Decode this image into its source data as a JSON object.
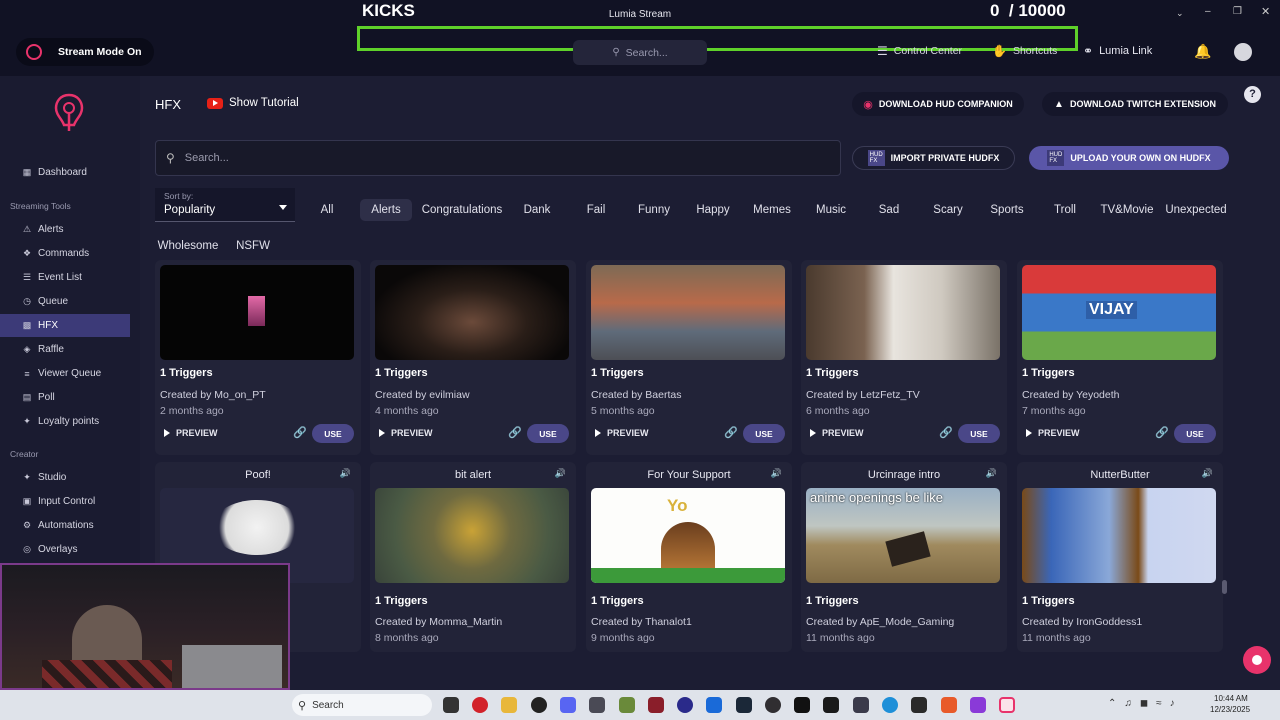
{
  "app": {
    "title": "Lumia Stream"
  },
  "overlay": {
    "kicks_label": "KICKS",
    "counter": "0  / 10000"
  },
  "topbar": {
    "stream_mode": "Stream Mode",
    "stream_mode_state": "On",
    "search_placeholder": "Search...",
    "control_center": "Control Center",
    "shortcuts": "Shortcuts",
    "lumia_link": "Lumia Link"
  },
  "sidebar": {
    "dashboard": "Dashboard",
    "section_streaming": "Streaming Tools",
    "streaming_items": [
      "Alerts",
      "Commands",
      "Event List",
      "Queue",
      "HFX",
      "Raffle",
      "Viewer Queue",
      "Poll",
      "Loyalty points"
    ],
    "section_creator": "Creator",
    "creator_items": [
      "Studio",
      "Input Control",
      "Automations",
      "Overlays"
    ]
  },
  "header": {
    "page_title": "HFX",
    "show_tutorial": "Show Tutorial",
    "download_hud": "DOWNLOAD HUD COMPANION",
    "download_twitch": "DOWNLOAD TWITCH EXTENSION",
    "help": "?"
  },
  "search": {
    "placeholder": "Search..."
  },
  "actions": {
    "import_private": "IMPORT PRIVATE HUDFX",
    "upload_own": "UPLOAD YOUR OWN ON HUDFX",
    "hud_badge": "HUD",
    "fx_badge": "FX"
  },
  "sort": {
    "label": "Sort by:",
    "value": "Popularity"
  },
  "categories": [
    "All",
    "Alerts",
    "Congratulations",
    "Dank",
    "Fail",
    "Funny",
    "Happy",
    "Memes",
    "Music",
    "Sad",
    "Scary",
    "Sports",
    "Troll",
    "TV&Movie",
    "Unexpected",
    "Wholesome",
    "NSFW"
  ],
  "selected_category": "Alerts",
  "cards_row1": [
    {
      "triggers": "1 Triggers",
      "creator": "Created by Mo_on_PT",
      "ago": "2 months ago"
    },
    {
      "triggers": "1 Triggers",
      "creator": "Created by evilmiaw",
      "ago": "4 months ago"
    },
    {
      "triggers": "1 Triggers",
      "creator": "Created by Baertas",
      "ago": "5 months ago"
    },
    {
      "triggers": "1 Triggers",
      "creator": "Created by LetzFetz_TV",
      "ago": "6 months ago"
    },
    {
      "triggers": "1 Triggers",
      "creator": "Created by Yeyodeth",
      "ago": "7 months ago"
    }
  ],
  "cards_row2": [
    {
      "title": "Poof!",
      "triggers": "",
      "creator": "",
      "ago": ""
    },
    {
      "title": "bit alert",
      "triggers": "1 Triggers",
      "creator": "Created by Momma_Martin",
      "ago": "8 months ago"
    },
    {
      "title": "For Your Support",
      "triggers": "1 Triggers",
      "creator": "Created by Thanalot1",
      "ago": "9 months ago"
    },
    {
      "title": "Urcinrage intro",
      "triggers": "1 Triggers",
      "creator": "Created by ApE_Mode_Gaming",
      "ago": "11 months ago"
    },
    {
      "title": "NutterButter",
      "triggers": "1 Triggers",
      "creator": "Created by IronGoddess1",
      "ago": "11 months ago"
    }
  ],
  "card_actions": {
    "preview": "PREVIEW",
    "use": "USE"
  },
  "thumb_text": {
    "vijay": "VIJAY",
    "yo": "Yo",
    "anime": "anime openings be like"
  },
  "taskbar": {
    "search": "Search",
    "time": "10:44 AM",
    "date": "12/23/2025"
  },
  "colors": {
    "accent": "#4a4788",
    "active_nav": "#3c3a78",
    "brand_pink": "#e8336b",
    "overlay_green": "#5fd12a"
  }
}
